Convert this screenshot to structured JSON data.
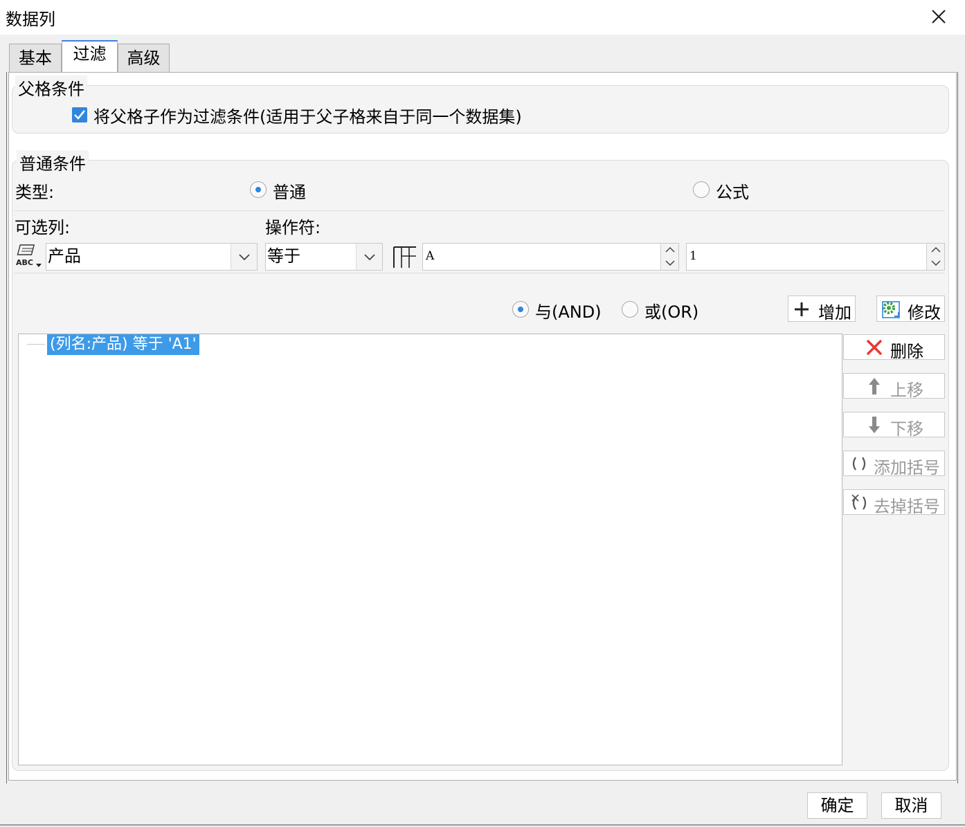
{
  "window": {
    "title": "数据列"
  },
  "tabs": [
    {
      "label": "基本",
      "active": false
    },
    {
      "label": "过滤",
      "active": true
    },
    {
      "label": "高级",
      "active": false
    }
  ],
  "parent_condition": {
    "legend": "父格条件",
    "checkbox_label": "将父格子作为过滤条件(适用于父子格来自于同一个数据集)",
    "checked": true
  },
  "normal_condition": {
    "legend": "普通条件",
    "type_label": "类型:",
    "type_options": [
      {
        "label": "普通",
        "selected": true
      },
      {
        "label": "公式",
        "selected": false
      }
    ],
    "column_label": "可选列:",
    "operator_label": "操作符:",
    "column_value": "产品",
    "operator_value": "等于",
    "value1": "A",
    "value2": "1",
    "logic_options": [
      {
        "label": "与(AND)",
        "selected": true
      },
      {
        "label": "或(OR)",
        "selected": false
      }
    ],
    "add_button": "增加",
    "modify_button": "修改"
  },
  "condition_list": [
    {
      "text": "(列名:产品) 等于 'A1'",
      "selected": true
    }
  ],
  "side_buttons": {
    "delete": "删除",
    "move_up": "上移",
    "move_down": "下移",
    "add_bracket": "添加括号",
    "remove_bracket": "去掉括号"
  },
  "footer": {
    "ok": "确定",
    "cancel": "取消"
  },
  "colors": {
    "accent": "#2f86e0",
    "selection": "#3d9ae8",
    "delete_red": "#e53935",
    "gear_green": "#43a047"
  },
  "icons": [
    "close-icon",
    "check-icon",
    "abc-column-icon",
    "chevron-down-icon",
    "cell-grid-icon",
    "spin-up-icon",
    "spin-down-icon",
    "plus-icon",
    "gear-edit-icon",
    "delete-x-icon",
    "arrow-up-icon",
    "arrow-down-icon",
    "bracket-icon",
    "remove-bracket-icon"
  ]
}
